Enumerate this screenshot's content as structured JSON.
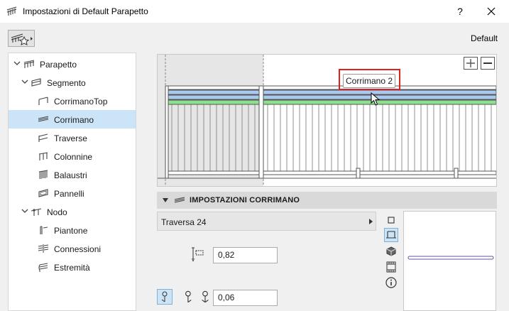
{
  "window": {
    "title": "Impostazioni di Default Parapetto",
    "help_label": "?"
  },
  "toolbar": {
    "favorites_icon": "railing-favorites-icon",
    "default_label": "Default"
  },
  "tree": {
    "items": [
      {
        "label": "Parapetto",
        "level": 0,
        "expanded": true,
        "icon": "railing-icon"
      },
      {
        "label": "Segmento",
        "level": 1,
        "expanded": true,
        "icon": "segment-icon"
      },
      {
        "label": "CorrimanoTop",
        "level": 2,
        "icon": "top-rail-icon"
      },
      {
        "label": "Corrimano",
        "level": 2,
        "icon": "handrail-icon",
        "selected": true
      },
      {
        "label": "Traverse",
        "level": 2,
        "icon": "rail-icon"
      },
      {
        "label": "Colonnine",
        "level": 2,
        "icon": "inner-post-icon"
      },
      {
        "label": "Balaustri",
        "level": 2,
        "icon": "baluster-icon"
      },
      {
        "label": "Pannelli",
        "level": 2,
        "icon": "panel-icon"
      },
      {
        "label": "Nodo",
        "level": 1,
        "expanded": true,
        "icon": "node-icon"
      },
      {
        "label": "Piantone",
        "level": 2,
        "icon": "post-icon"
      },
      {
        "label": "Connessioni",
        "level": 2,
        "icon": "connection-icon"
      },
      {
        "label": "Estremità",
        "level": 2,
        "icon": "end-icon"
      }
    ]
  },
  "preview": {
    "tooltip": "Corrimano 2",
    "zoom_in": "+",
    "zoom_out": "−"
  },
  "section": {
    "title": "IMPOSTAZIONI CORRIMANO"
  },
  "profile": {
    "selected": "Traversa 24"
  },
  "params": {
    "height_value": "0,82",
    "offset_value": "0,06"
  },
  "colors": {
    "selection": "#cce4f7",
    "highlight_rail_blue": "#a9c9f0",
    "highlight_rail_green": "#8de08d",
    "tooltip_border": "#e02020"
  }
}
